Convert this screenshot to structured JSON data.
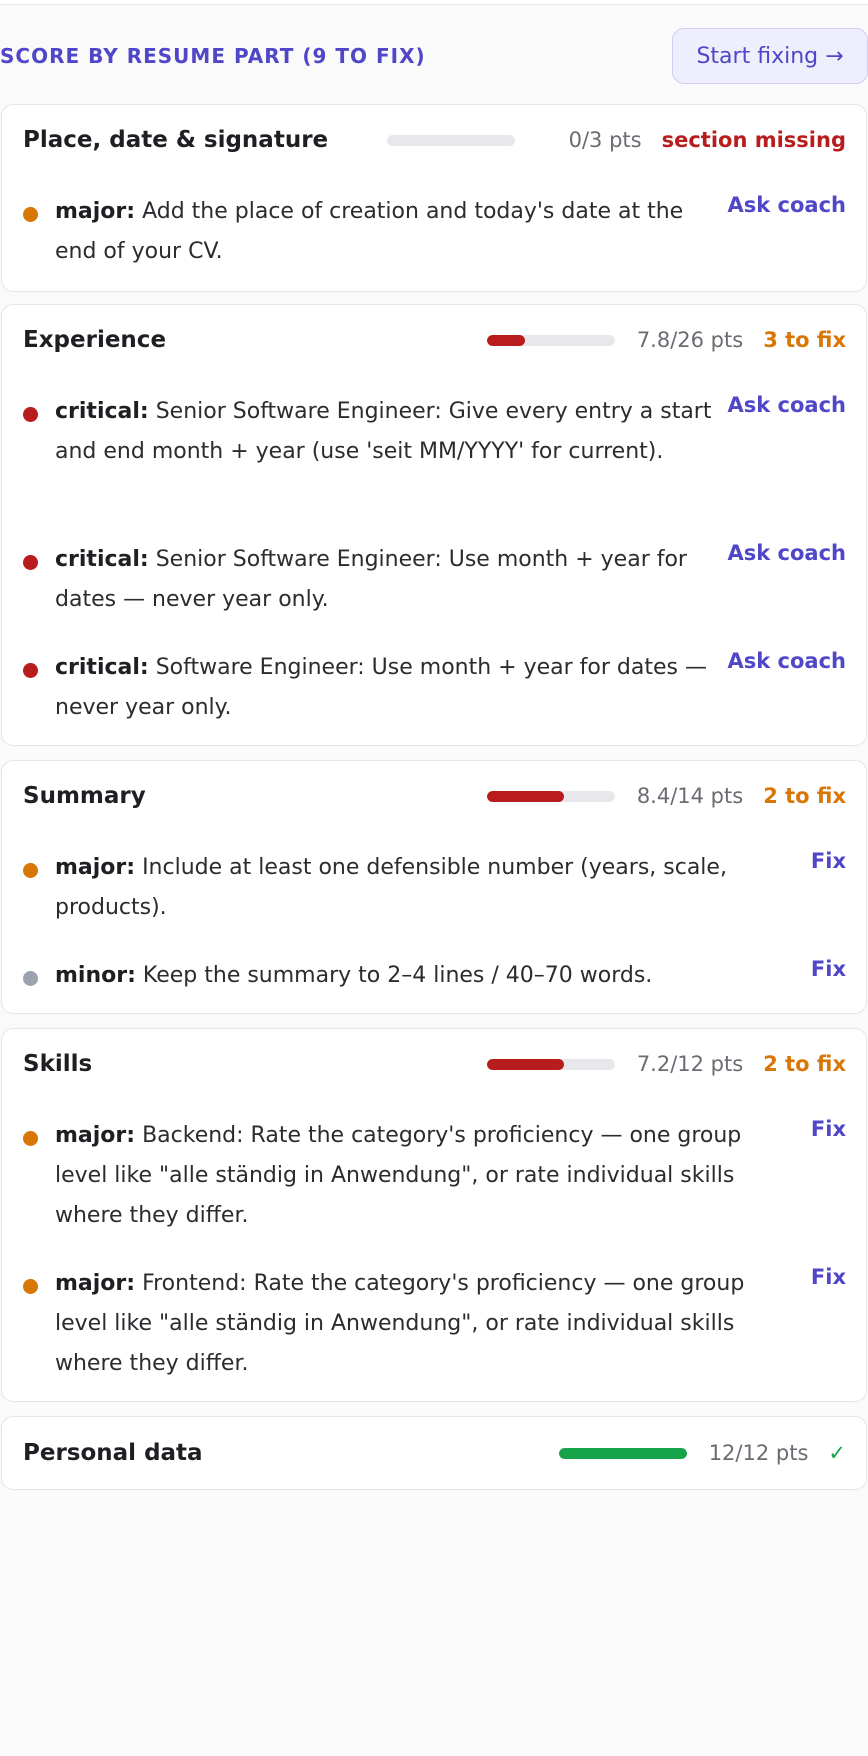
{
  "header": {
    "title": "SCORE BY RESUME PART (9 TO FIX)",
    "start_button": "Start fixing →"
  },
  "colors": {
    "accent": "#4f46c8",
    "critical": "#b91c1c",
    "major": "#d97706",
    "minor": "#9ca3af",
    "success": "#16a34a",
    "missing": "#b91c1c"
  },
  "sections": [
    {
      "title": "Place, date & signature",
      "points": "0/3 pts",
      "progress": 0.0,
      "status": "section missing",
      "issues": [
        {
          "severity": "major:",
          "text": " Add the place of creation and today's date at the end of your CV.",
          "action": "Ask coach"
        }
      ]
    },
    {
      "title": "Experience",
      "points": "7.8/26 pts",
      "progress": 0.3,
      "status": "3 to fix",
      "issues": [
        {
          "severity": "critical:",
          "text": " Senior Software Engineer: Give every entry a start and end month + year (use 'seit MM/YYYY' for current).",
          "action": "Ask coach"
        },
        {
          "severity": "critical:",
          "text": " Senior Software Engineer: Use month + year for dates — never year only.",
          "action": "Ask coach"
        },
        {
          "severity": "critical:",
          "text": " Software Engineer: Use month + year for dates — never year only.",
          "action": "Ask coach"
        }
      ]
    },
    {
      "title": "Summary",
      "points": "8.4/14 pts",
      "progress": 0.6,
      "status": "2 to fix",
      "issues": [
        {
          "severity": "major:",
          "text": " Include at least one defensible number (years, scale, products).",
          "action": "Fix"
        },
        {
          "severity": "minor:",
          "text": " Keep the summary to 2–4 lines / 40–70 words.",
          "action": "Fix"
        }
      ]
    },
    {
      "title": "Skills",
      "points": "7.2/12 pts",
      "progress": 0.6,
      "status": "2 to fix",
      "issues": [
        {
          "severity": "major:",
          "text": " Backend: Rate the category's proficiency — one group level like \"alle ständig in Anwendung\", or rate individual skills where they differ.",
          "action": "Fix"
        },
        {
          "severity": "major:",
          "text": " Frontend: Rate the category's proficiency — one group level like \"alle ständig in Anwendung\", or rate individual skills where they differ.",
          "action": "Fix"
        }
      ]
    },
    {
      "title": "Personal data",
      "points": "12/12 pts",
      "progress": 1.0,
      "status": "✓",
      "issues": []
    }
  ]
}
